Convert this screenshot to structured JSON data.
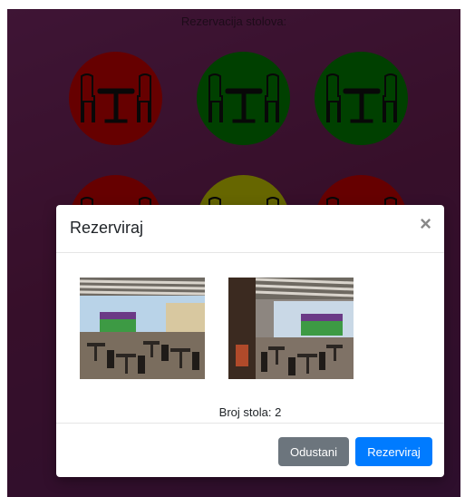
{
  "page": {
    "title": "Rezervacija stolova:"
  },
  "tables": [
    {
      "status": "reserved",
      "color": "#cc0000"
    },
    {
      "status": "free",
      "color": "#008000"
    },
    {
      "status": "free",
      "color": "#008000"
    },
    {
      "status": "reserved",
      "color": "#cc0000"
    },
    {
      "status": "pending",
      "color": "#cccc00"
    },
    {
      "status": "reserved",
      "color": "#cc0000"
    }
  ],
  "modal": {
    "title": "Rezerviraj",
    "close_label": "×",
    "photos": [
      {
        "alt": ""
      },
      {
        "alt": ""
      }
    ],
    "table_number_text": "Broj stola: 2",
    "cancel_label": "Odustani",
    "reserve_label": "Rezerviraj"
  },
  "colors": {
    "cancel_button": "#6c757d",
    "reserve_button": "#007bff"
  }
}
